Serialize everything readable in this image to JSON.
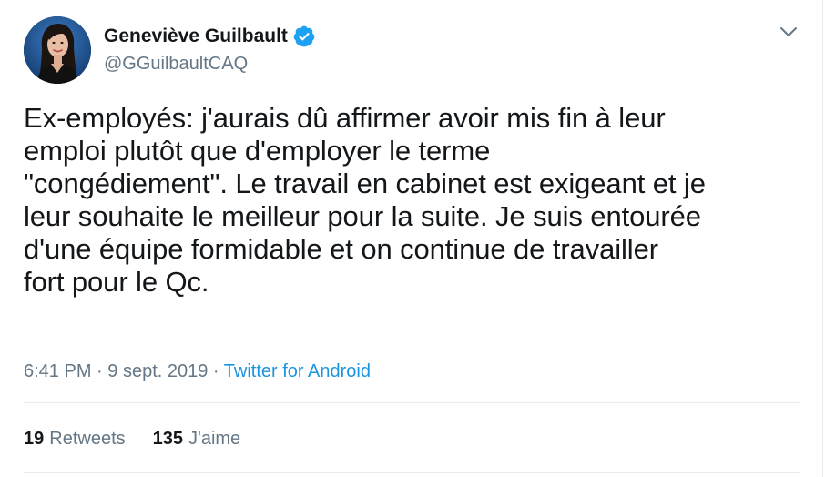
{
  "author": {
    "name": "Geneviève Guilbault",
    "handle": "@GGuilbaultCAQ",
    "verified_icon": "verified-badge-icon",
    "verified_color": "#1da1f2"
  },
  "tweet": {
    "text": "Ex-employés: j'aurais dû affirmer avoir mis fin à leur\nemploi plutôt que d'employer le terme\n\"congédiement\". Le travail en cabinet est exigeant et je\nleur souhaite le meilleur pour la suite. Je suis entourée\nd'une équipe formidable et on continue de travailler\nfort pour le Qc.",
    "time": "6:41 PM",
    "separator": "·",
    "date": "9 sept. 2019",
    "source": "Twitter for Android"
  },
  "stats": {
    "retweets_count": "19",
    "retweets_label": "Retweets",
    "likes_count": "135",
    "likes_label": "J'aime"
  },
  "colors": {
    "text": "#14171a",
    "secondary": "#657786",
    "link": "#1b95e0",
    "divider": "#e6ecf0"
  },
  "icons": {
    "menu": "chevron-down-icon"
  }
}
